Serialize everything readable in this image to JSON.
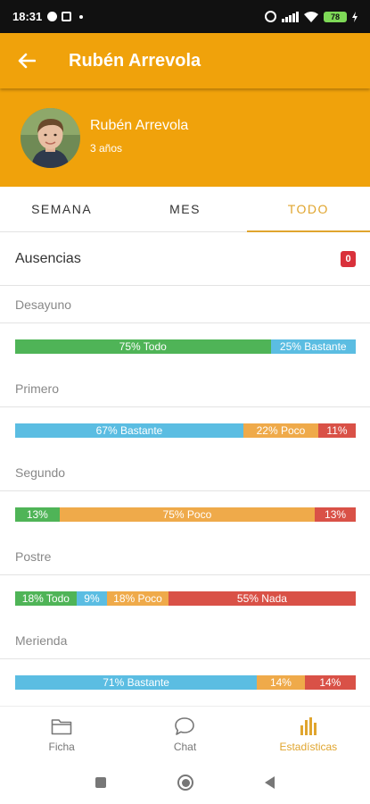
{
  "status_bar": {
    "time": "18:31",
    "battery": "78"
  },
  "app_bar": {
    "title": "Rubén Arrevola",
    "back_icon": "arrow-left-icon"
  },
  "profile": {
    "name": "Rubén Arrevola",
    "age": "3 años"
  },
  "tabs": [
    {
      "label": "SEMANA",
      "active": false
    },
    {
      "label": "MES",
      "active": false
    },
    {
      "label": "TODO",
      "active": true
    }
  ],
  "absences": {
    "label": "Ausencias",
    "count": "0"
  },
  "colors": {
    "accent": "#f0a20b",
    "todo": "#4fb457",
    "bastante": "#5bbde2",
    "poco": "#efaa4a",
    "nada": "#d95147",
    "badge": "#d9313b"
  },
  "meals": [
    {
      "name": "Desayuno",
      "segments": [
        {
          "type": "todo",
          "percent": 75,
          "label": "75% Todo"
        },
        {
          "type": "bastante",
          "percent": 25,
          "label": "25% Bastante"
        }
      ]
    },
    {
      "name": "Primero",
      "segments": [
        {
          "type": "bastante",
          "percent": 67,
          "label": "67% Bastante"
        },
        {
          "type": "poco",
          "percent": 22,
          "label": "22% Poco"
        },
        {
          "type": "nada",
          "percent": 11,
          "label": "11%"
        }
      ]
    },
    {
      "name": "Segundo",
      "segments": [
        {
          "type": "todo",
          "percent": 13,
          "label": "13%"
        },
        {
          "type": "poco",
          "percent": 75,
          "label": "75% Poco"
        },
        {
          "type": "nada",
          "percent": 12,
          "label": "13%"
        }
      ]
    },
    {
      "name": "Postre",
      "segments": [
        {
          "type": "todo",
          "percent": 18,
          "label": "18% Todo"
        },
        {
          "type": "bastante",
          "percent": 9,
          "label": "9%"
        },
        {
          "type": "poco",
          "percent": 18,
          "label": "18% Poco"
        },
        {
          "type": "nada",
          "percent": 55,
          "label": "55% Nada"
        }
      ]
    },
    {
      "name": "Merienda",
      "segments": [
        {
          "type": "bastante",
          "percent": 71,
          "label": "71% Bastante"
        },
        {
          "type": "poco",
          "percent": 14,
          "label": "14%"
        },
        {
          "type": "nada",
          "percent": 15,
          "label": "14%"
        }
      ]
    }
  ],
  "bottom_nav": [
    {
      "label": "Ficha",
      "icon": "folder-icon",
      "active": false
    },
    {
      "label": "Chat",
      "icon": "chat-bubble-icon",
      "active": false
    },
    {
      "label": "Estadísticas",
      "icon": "bar-chart-icon",
      "active": true
    }
  ]
}
